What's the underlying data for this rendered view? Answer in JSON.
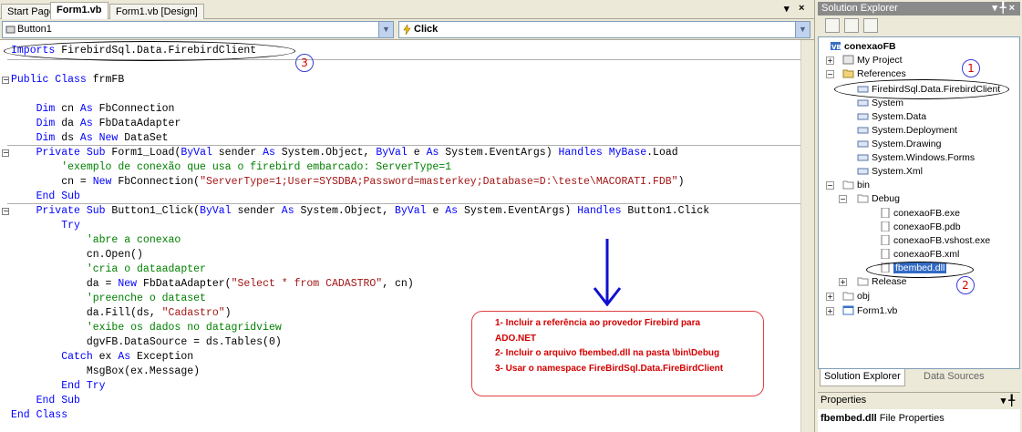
{
  "editor": {
    "tabs": [
      {
        "label": "Start Page"
      },
      {
        "label": "Form1.vb"
      },
      {
        "label": "Form1.vb [Design]"
      }
    ],
    "tab_controls": {
      "dropdown": "▾",
      "close": "×"
    },
    "object_combo": "Button1",
    "event_combo": "Click",
    "code_lines": {
      "l1": "Imports FirebirdSql.Data.FirebirdClient",
      "l2a": "Public Class",
      "l2b": " frmFB",
      "l3a": "    Dim",
      "l3b": " cn ",
      "l3c": "As",
      "l3d": " FbConnection",
      "l4a": "    Dim",
      "l4b": " da ",
      "l4c": "As",
      "l4d": " FbDataAdapter",
      "l5a": "    Dim",
      "l5b": " ds ",
      "l5c": "As New",
      "l5d": " DataSet",
      "l6a": "    Private Sub",
      "l6b": " Form1_Load(",
      "l6c": "ByVal",
      "l6d": " sender ",
      "l6e": "As",
      "l6f": " System.Object, ",
      "l6g": "ByVal",
      "l6h": " e ",
      "l6i": "As",
      "l6j": " System.EventArgs) ",
      "l6k": "Handles",
      "l6l": " ",
      "l6m": "MyBase",
      "l6n": ".Load",
      "l7": "        'exemplo de conexão que usa o firebird embarcado: ServerType=1",
      "l8a": "        cn = ",
      "l8b": "New",
      "l8c": " FbConnection(",
      "l8d": "\"ServerType=1;User=SYSDBA;Password=masterkey;Database=D:\\teste\\MACORATI.FDB\"",
      "l8e": ")",
      "l9": "    End Sub",
      "l10a": "    Private Sub",
      "l10b": " Button1_Click(",
      "l10c": "ByVal",
      "l10d": " sender ",
      "l10e": "As",
      "l10f": " System.Object, ",
      "l10g": "ByVal",
      "l10h": " e ",
      "l10i": "As",
      "l10j": " System.EventArgs) ",
      "l10k": "Handles",
      "l10l": " Button1.Click",
      "l11": "        Try",
      "l12": "            'abre a conexao",
      "l13": "            cn.Open()",
      "l14": "            'cria o dataadapter",
      "l15a": "            da = ",
      "l15b": "New",
      "l15c": " FbDataAdapter(",
      "l15d": "\"Select * from CADASTRO\"",
      "l15e": ", cn)",
      "l16": "            'preenche o dataset",
      "l17a": "            da.Fill(ds, ",
      "l17b": "\"Cadastro\"",
      "l17c": ")",
      "l18": "            'exibe os dados no datagridview",
      "l19": "            dgvFB.DataSource = ds.Tables(0)",
      "l20a": "        Catch",
      "l20b": " ex ",
      "l20c": "As",
      "l20d": " Exception",
      "l21": "            MsgBox(ex.Message)",
      "l22": "        End Try",
      "l23": "    End Sub",
      "l24": "End Class"
    }
  },
  "annotations": {
    "badge1": "1",
    "badge2": "2",
    "badge3": "3",
    "note_lines": [
      "1- Incluir a referência ao provedor Firebird para",
      "ADO.NET",
      "2- Incluir o arquivo fbembed.dll na pasta \\bin\\Debug",
      "3- Usar o namespace FireBirdSql.Data.FireBirdClient"
    ],
    "arrow_color": "#1010d0",
    "note_color": "#d40000"
  },
  "solution_explorer": {
    "title": "Solution Explorer",
    "title_controls": "▾ ╀ ×",
    "tree": {
      "project": "conexaoFB",
      "my_project": "My Project",
      "references": "References",
      "refs": [
        "FirebirdSql.Data.FirebirdClient",
        "System",
        "System.Data",
        "System.Deployment",
        "System.Drawing",
        "System.Windows.Forms",
        "System.Xml"
      ],
      "bin": "bin",
      "debug": "Debug",
      "debug_files": [
        "conexaoFB.exe",
        "conexaoFB.pdb",
        "conexaoFB.vshost.exe",
        "conexaoFB.xml",
        "fbembed.dll"
      ],
      "release": "Release",
      "obj": "obj",
      "form1": "Form1.vb"
    },
    "bottom_tabs": [
      "Solution Explorer",
      "Data Sources"
    ]
  },
  "properties": {
    "title": "Properties",
    "title_controls": "▾ ╀",
    "selected_name": "fbembed.dll",
    "selected_type": "File Properties"
  }
}
